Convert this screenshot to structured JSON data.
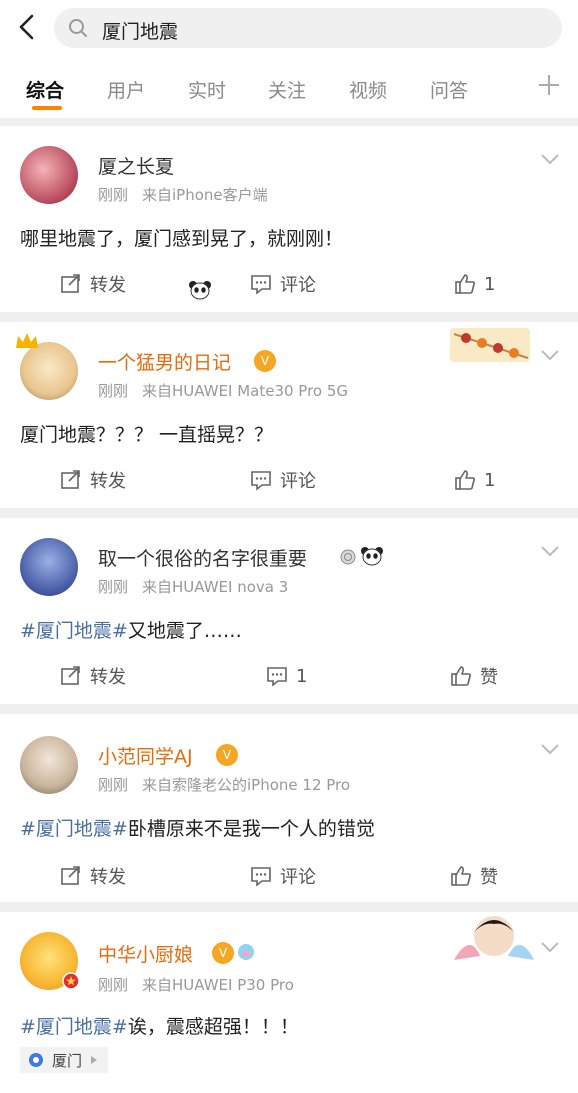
{
  "search": {
    "query": "厦门地震"
  },
  "tabs": [
    "综合",
    "用户",
    "实时",
    "关注",
    "视频",
    "问答"
  ],
  "actions": {
    "repost": "转发",
    "comment": "评论"
  },
  "posts": [
    {
      "name": "厦之长夏",
      "time": "刚刚",
      "source": "来自iPhone客户端",
      "text": "哪里地震了，厦门感到晃了，就刚刚！",
      "comments": "评论",
      "likes": "1"
    },
    {
      "name": "一个猛男的日记",
      "time": "刚刚",
      "source": "来自HUAWEI Mate30 Pro 5G",
      "text": "厦门地震？？？ 一直摇晃？？",
      "comments": "评论",
      "likes": "1"
    },
    {
      "name": "取一个很俗的名字很重要",
      "time": "刚刚",
      "source": "来自HUAWEI nova 3",
      "hashtag": "#厦门地震#",
      "text": "又地震了……",
      "comments": "1",
      "likes": "赞"
    },
    {
      "name": "小范同学AJ",
      "time": "刚刚",
      "source": "来自索隆老公的iPhone 12 Pro",
      "hashtag": "#厦门地震#",
      "text": "卧槽原来不是我一个人的错觉",
      "comments": "评论",
      "likes": "赞"
    },
    {
      "name": "中华小厨娘",
      "time": "刚刚",
      "source": "来自HUAWEI P30 Pro",
      "hashtag": "#厦门地震#",
      "text": "诶，震感超强！！！",
      "location": "厦门"
    }
  ],
  "colors": {
    "accent": "#ff8200",
    "vip_name": "#e86b0c",
    "hashtag": "#4a6fa5"
  }
}
